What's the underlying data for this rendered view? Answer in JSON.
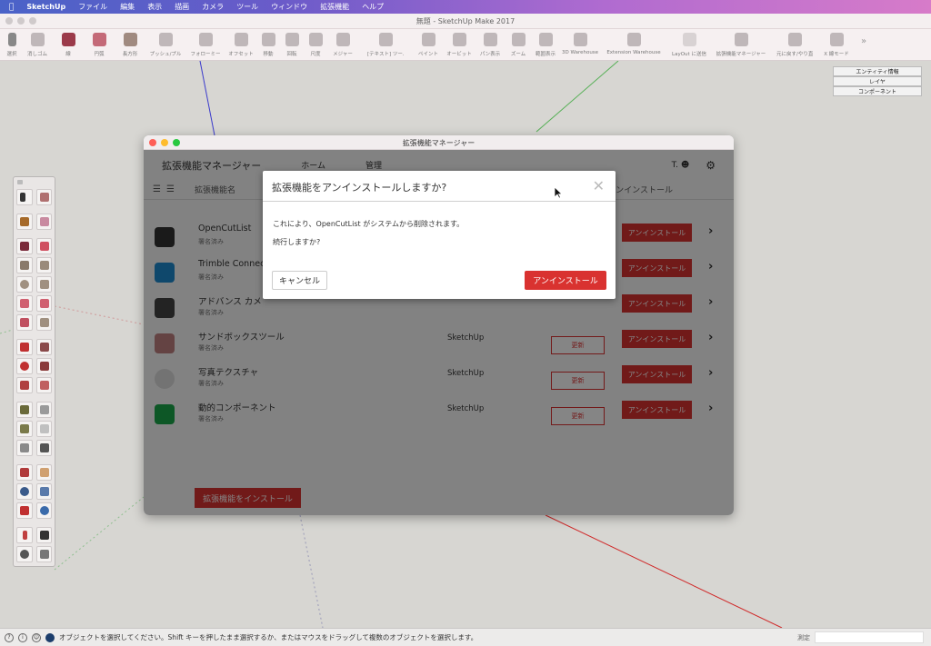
{
  "menubar": {
    "items": [
      "SketchUp",
      "ファイル",
      "編集",
      "表示",
      "描画",
      "カメラ",
      "ツール",
      "ウィンドウ",
      "拡張機能",
      "ヘルプ"
    ]
  },
  "window": {
    "title": "無題 - SketchUp Make 2017"
  },
  "toolbar": {
    "tools": [
      "選択",
      "消しゴム",
      "線",
      "円弧",
      "長方形",
      "プッシュ/プル",
      "フォローミー",
      "オフセット",
      "移動",
      "回転",
      "尺度",
      "メジャー",
      "[テキスト] ツール",
      "ペイント",
      "オービット",
      "パン表示",
      "ズーム",
      "範囲表示",
      "3D Warehouse",
      "Extension Warehouse",
      "LayOut に送信",
      "拡張機能マネージャー",
      "元に戻す/やり直し",
      "X 線モード"
    ]
  },
  "tray": {
    "buttons": [
      "エンティティ情報",
      "レイヤ",
      "コンポーネント"
    ]
  },
  "ext_window": {
    "title": "拡張機能マネージャー",
    "header": {
      "title": "拡張機能マネージャー",
      "tabs": [
        "ホーム",
        "管理"
      ],
      "user": "T."
    },
    "columns": {
      "name": "拡張機能名",
      "action": "アンインストール"
    },
    "rows": [
      {
        "name": "OpenCutList",
        "status": "署名済み",
        "author": "",
        "update": "",
        "uninstall": "アンインストール"
      },
      {
        "name": "Trimble Connect",
        "status": "署名済み",
        "author": "",
        "update": "",
        "uninstall": "アンインストール"
      },
      {
        "name": "アドバンス カメ",
        "status": "署名済み",
        "author": "",
        "update": "",
        "uninstall": "アンインストール"
      },
      {
        "name": "サンドボックスツール",
        "status": "署名済み",
        "author": "SketchUp",
        "update": "更新",
        "uninstall": "アンインストール"
      },
      {
        "name": "写真テクスチャ",
        "status": "署名済み",
        "author": "SketchUp",
        "update": "更新",
        "uninstall": "アンインストール"
      },
      {
        "name": "動的コンポーネント",
        "status": "署名済み",
        "author": "SketchUp",
        "update": "更新",
        "uninstall": "アンインストール"
      }
    ],
    "install_button": "拡張機能をインストール"
  },
  "dialog": {
    "title": "拡張機能をアンインストールしますか?",
    "close": "✕",
    "message": "これにより、OpenCutList がシステムから削除されます。",
    "question": "続行しますか?",
    "cancel": "キャンセル",
    "confirm": "アンインストール"
  },
  "statusbar": {
    "text": "オブジェクトを選択してください。Shift キーを押したまま選択するか、またはマウスをドラッグして複数のオブジェクトを選択します。",
    "measure_label": "測定"
  },
  "colors": {
    "accent": "#d93230",
    "menubar_start": "#4a63c8",
    "menubar_end": "#d77bc9"
  }
}
